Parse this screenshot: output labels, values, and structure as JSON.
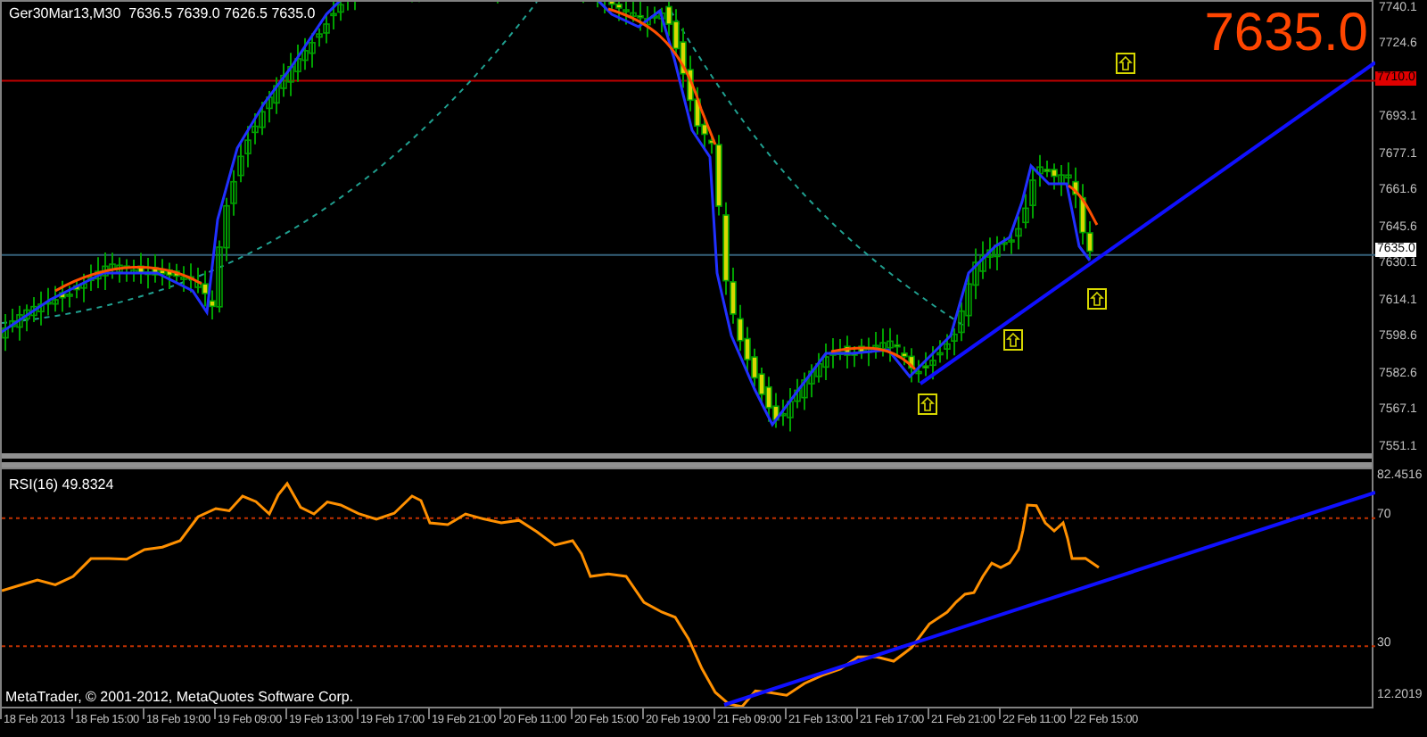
{
  "header": {
    "symbol": "Ger30Mar13,M30",
    "quote": "7636.5 7639.0 7626.5 7635.0"
  },
  "big_price": "7635.0",
  "price_axis": {
    "ticks": [
      "7740.1",
      "7724.6",
      "7693.1",
      "7677.1",
      "7661.6",
      "7645.6",
      "7630.1",
      "7614.1",
      "7598.6",
      "7582.6",
      "7567.1",
      "7551.1"
    ],
    "level_line": "7710.0",
    "current": "7635.0"
  },
  "rsi": {
    "label": "RSI(16) 49.8324",
    "ticks": [
      "82.4516",
      "70",
      "30",
      "12.2019"
    ]
  },
  "copyright": "MetaTrader, © 2001-2012, MetaQuotes Software Corp.",
  "time_axis": [
    "18 Feb 2013",
    "18 Feb 15:00",
    "18 Feb 19:00",
    "19 Feb 09:00",
    "19 Feb 13:00",
    "19 Feb 17:00",
    "19 Feb 21:00",
    "20 Feb 11:00",
    "20 Feb 15:00",
    "20 Feb 19:00",
    "21 Feb 09:00",
    "21 Feb 13:00",
    "21 Feb 17:00",
    "21 Feb 21:00",
    "22 Feb 11:00",
    "22 Feb 15:00"
  ]
}
